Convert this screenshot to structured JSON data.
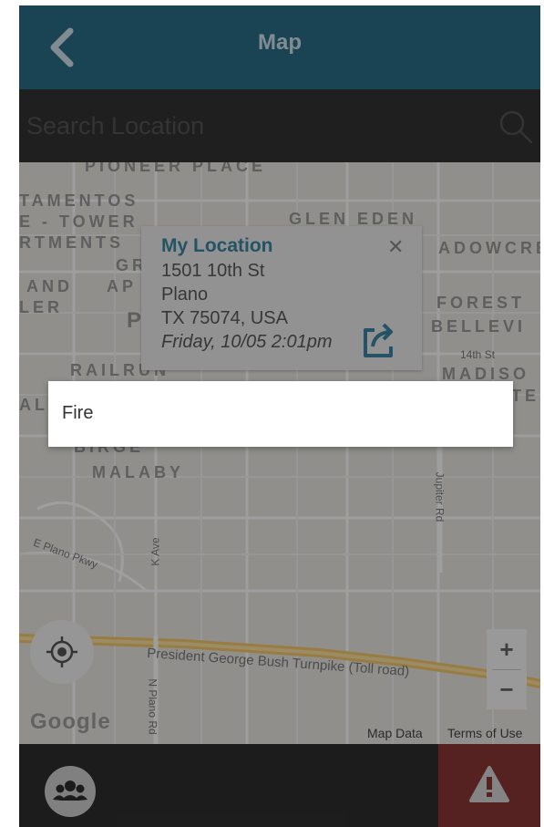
{
  "header": {
    "title": "Map",
    "back_icon": "chevron-left-icon"
  },
  "search": {
    "placeholder": "Search Location",
    "icon": "search-icon"
  },
  "map": {
    "area_labels": [
      "PIONEER PLACE",
      "TAMENTOS",
      "E - TOWER",
      "RTMENTS",
      "GR",
      "AND",
      "AP",
      "LER",
      "P",
      "GLEN EDEN",
      "ADOWCRE",
      "FOREST",
      "BELLEVI",
      "MADISO",
      "TE",
      "RAILRUN",
      "AL",
      "BIRGE",
      "MALABY"
    ],
    "road_labels": {
      "fourteenth": "14th St",
      "jupiter": "Jupiter Rd",
      "k_ave": "K Ave",
      "e_plano": "E Plano Pkwy",
      "turnpike": "President George Bush Turnpike (Toll road)",
      "n_plano": "N Plano Rd"
    },
    "locate_icon": "crosshair-icon",
    "zoom_in": "+",
    "zoom_out": "−",
    "google_logo": "Google",
    "map_data": "Map Data",
    "terms": "Terms of Use"
  },
  "info_window": {
    "title": "My Location",
    "close": "✕",
    "address_line1": "1501 10th St",
    "address_line2": "Plano",
    "address_line3": "TX 75074, USA",
    "timestamp": "Friday, 10/05 2:01pm",
    "share_icon": "share-icon"
  },
  "dropdown": {
    "option_label": "Fire"
  },
  "bottom_bar": {
    "group_icon": "group-icon",
    "alert_icon": "warning-icon"
  },
  "colors": {
    "header_bg": "#2b6f86",
    "accent": "#3a86a3",
    "alert_bg": "#8c3636",
    "bottom_bg": "#2e2e2e"
  }
}
